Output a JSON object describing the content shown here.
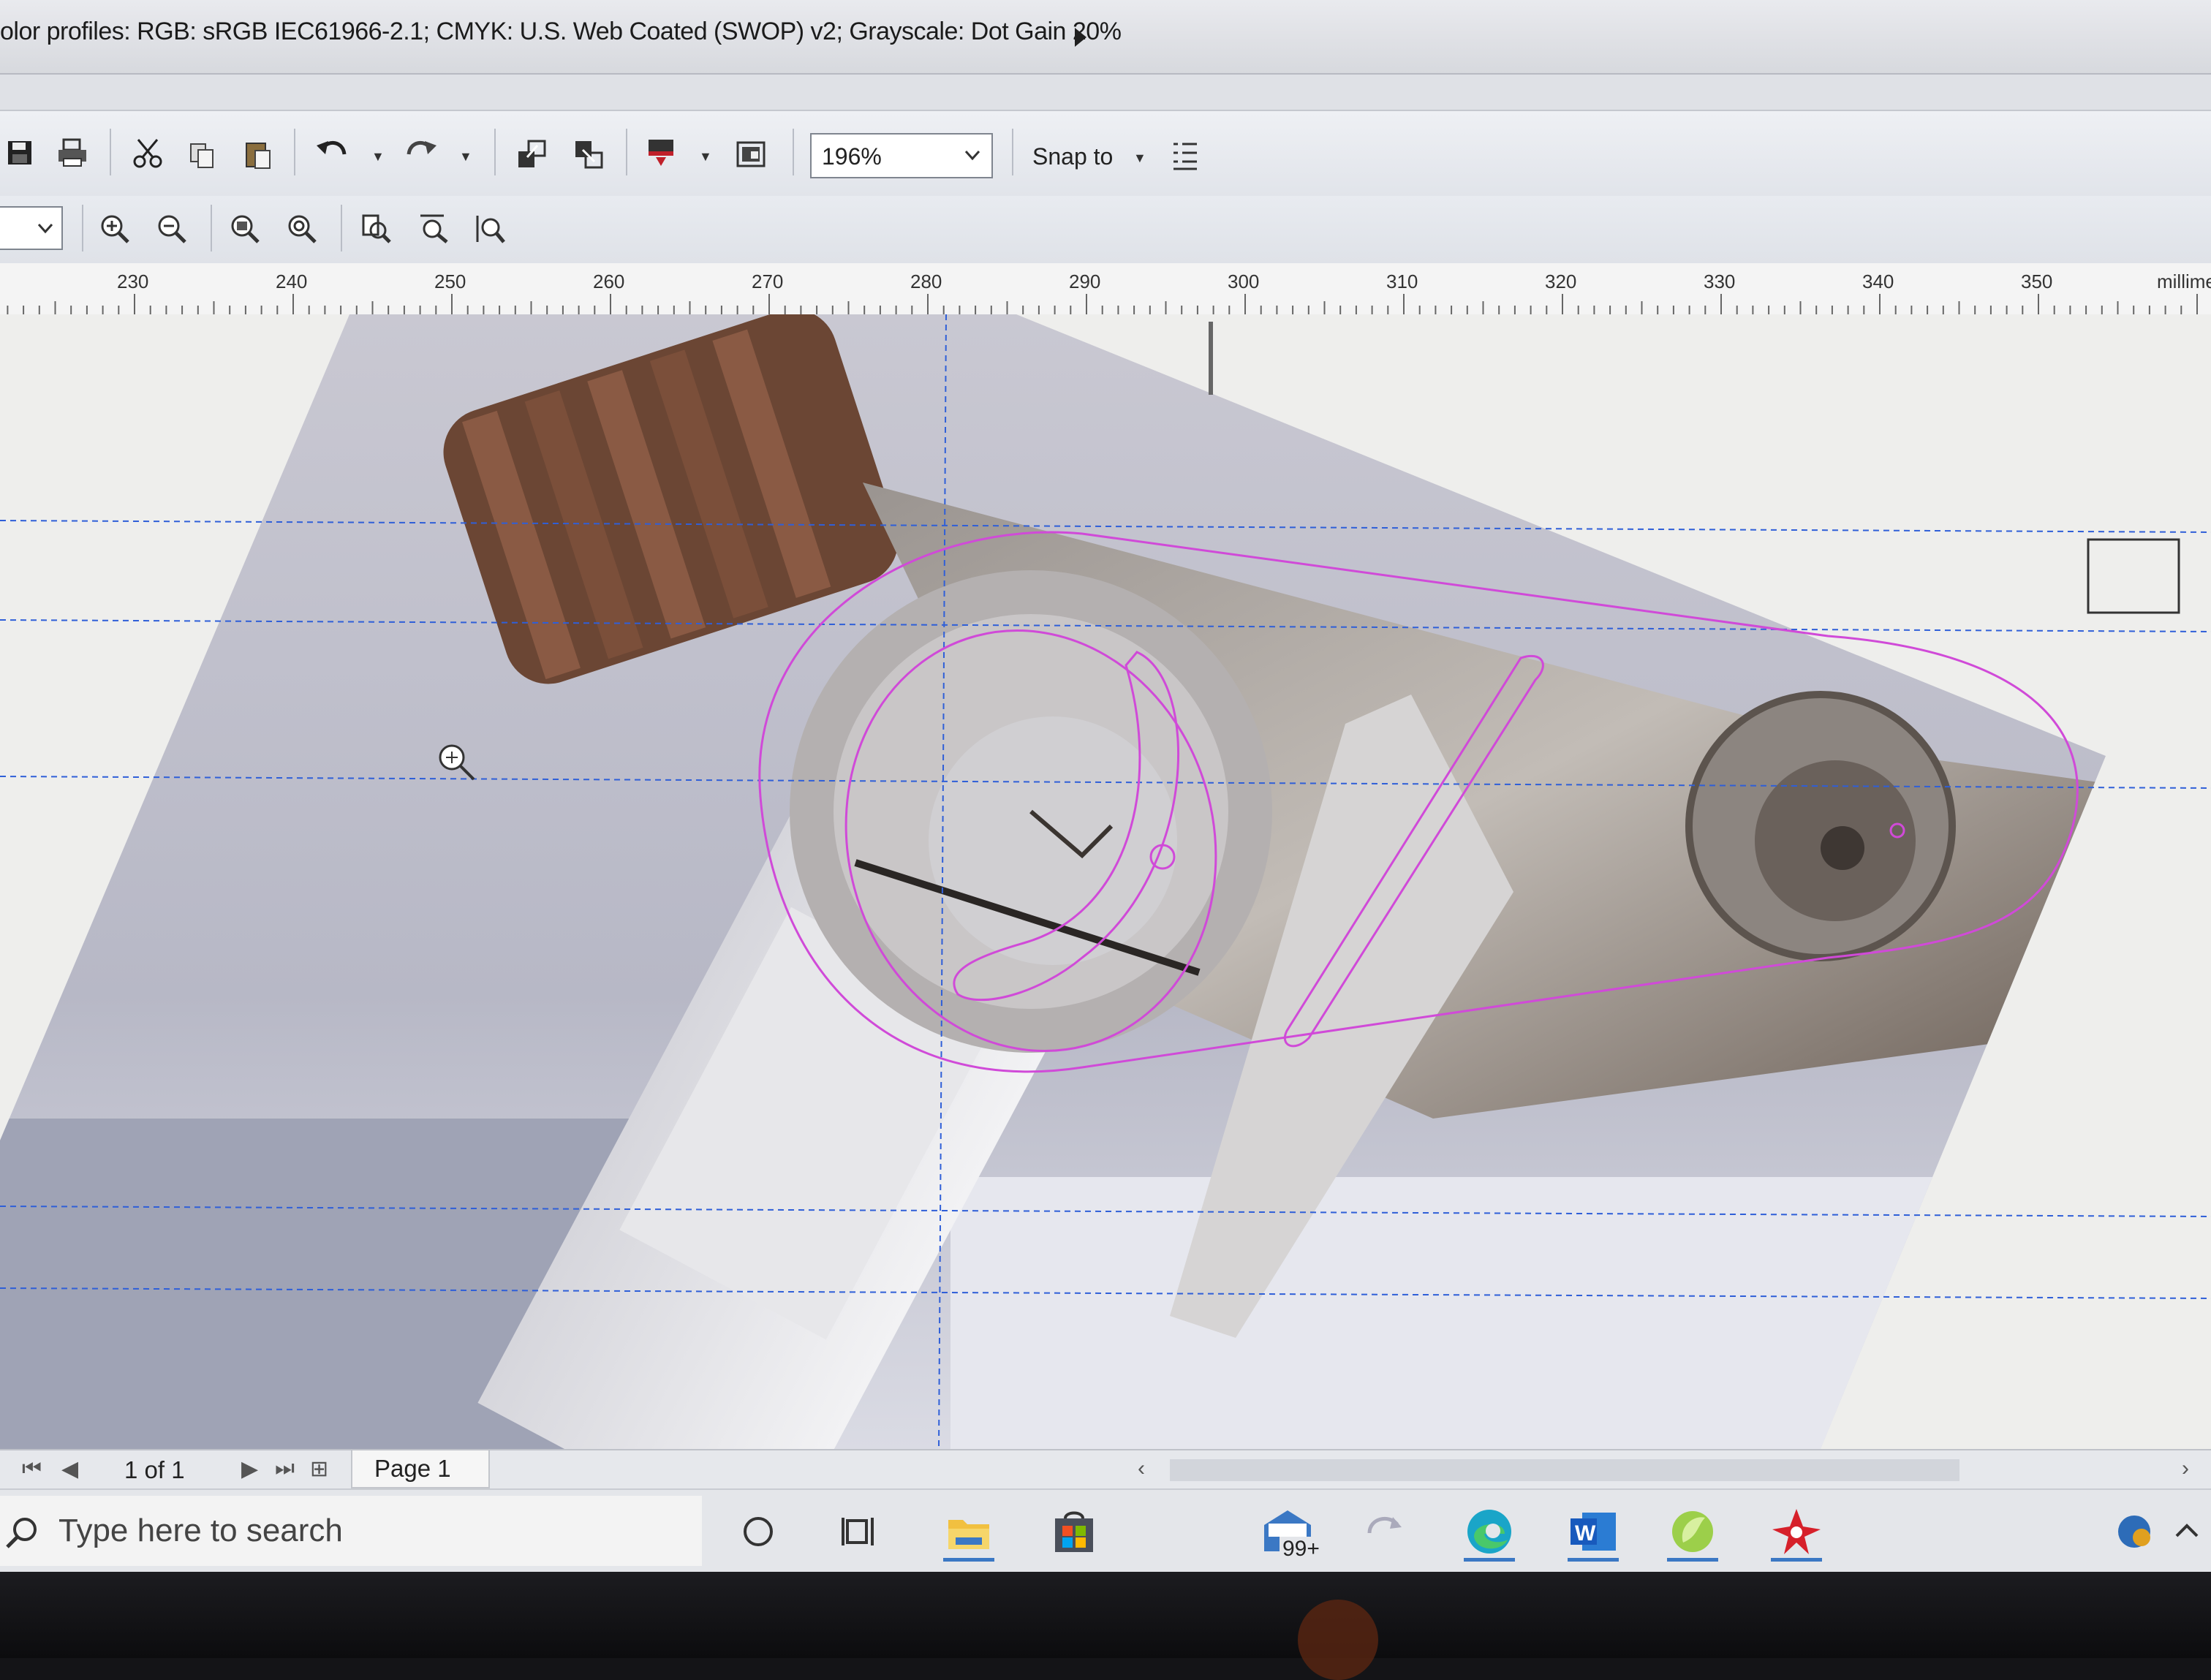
{
  "status_bar": {
    "color_profiles": "olor profiles: RGB: sRGB IEC61966-2.1; CMYK: U.S. Web Coated (SWOP) v2; Grayscale: Dot Gain 20%"
  },
  "toolbar": {
    "zoom_value": "196%",
    "snap_to_label": "Snap to",
    "icons": [
      "save-icon",
      "print-icon",
      "cut-icon",
      "copy-icon",
      "paste-icon",
      "undo-icon",
      "redo-icon",
      "import-icon",
      "export-icon",
      "publish-pdf-icon",
      "full-screen-preview-icon",
      "snap-options-icon"
    ]
  },
  "view_toolbar": {
    "icons": [
      "zoom-in-icon",
      "zoom-out-icon",
      "zoom-to-selected-icon",
      "zoom-to-all-objects-icon",
      "zoom-to-page-icon",
      "zoom-to-page-width-icon",
      "zoom-to-page-height-icon"
    ]
  },
  "ruler": {
    "unit": "millime",
    "labels": [
      "230",
      "240",
      "250",
      "260",
      "270",
      "280",
      "290",
      "300",
      "310",
      "320",
      "330",
      "340",
      "350"
    ]
  },
  "page_nav": {
    "count": "1 of 1",
    "tab_label": "Page 1"
  },
  "taskbar": {
    "search_placeholder": "Type here to search",
    "mail_badge": "99+"
  },
  "colors": {
    "guide": "#2f5fd8",
    "outline": "#d04ad8",
    "accent": "#3b78c4"
  }
}
